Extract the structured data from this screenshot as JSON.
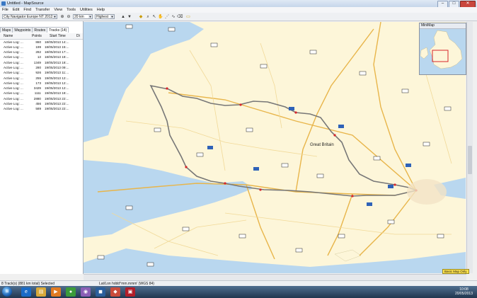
{
  "window": {
    "title": "Untitled - MapSource",
    "min": "–",
    "max": "□",
    "close": "✕"
  },
  "menu": [
    "File",
    "Edit",
    "Find",
    "Transfer",
    "View",
    "Tools",
    "Utilities",
    "Help"
  ],
  "toolbar": {
    "map_product": "City Navigator Europe NT 2012.2",
    "zoom": "20 km",
    "detail": "Highest",
    "icons": [
      "zoom-in-icon",
      "zoom-out-icon",
      "find-icon",
      "select-icon",
      "hand-icon",
      "route-icon",
      "measure-icon"
    ]
  },
  "tabs": [
    "Maps",
    "Waypoints",
    "Routes",
    "Tracks (14)"
  ],
  "tracks_table": {
    "headers": [
      "Name",
      "Points",
      "Start Time",
      "Di"
    ],
    "rows": [
      [
        "Active Log: ...",
        "860",
        "18/05/2013 14:..."
      ],
      [
        "Active Log: ...",
        "199",
        "18/05/2013 15:..."
      ],
      [
        "Active Log: ...",
        "282",
        "18/05/2013 17:..."
      ],
      [
        "Active Log: ...",
        "13",
        "18/05/2013 18:..."
      ],
      [
        "Active Log: ...",
        "1349",
        "18/05/2013 18:..."
      ],
      [
        "Active Log: ...",
        "280",
        "19/05/2013 09:..."
      ],
      [
        "Active Log: ...",
        "926",
        "19/05/2013 11:..."
      ],
      [
        "Active Log: ...",
        "255",
        "19/05/2013 12:..."
      ],
      [
        "Active Log: ...",
        "173",
        "19/05/2013 12:..."
      ],
      [
        "Active Log: ...",
        "3429",
        "19/05/2013 12:..."
      ],
      [
        "Active Log: ...",
        "1111",
        "19/05/2013 18:..."
      ],
      [
        "Active Log: ...",
        "2880",
        "19/05/2013 22:..."
      ],
      [
        "Active Log: ...",
        "456",
        "19/05/2013 22:..."
      ],
      [
        "Active Log: ...",
        "589",
        "19/05/2013 22:..."
      ]
    ]
  },
  "map": {
    "region_label": "Great Britain",
    "minimap_title": "MiniMap",
    "basic_map_badge": "Basic Map Only",
    "colors": {
      "land": "#fdf6d9",
      "sea": "#b9d7ef",
      "track": "#777777",
      "road_major": "#e8b54a",
      "road_minor": "#f1d998"
    }
  },
  "status": {
    "left": "8 Track(s) (881 km total) Selected",
    "right": "Lat/Lon hddd°mm.mmm' (WGS 84)"
  },
  "taskbar": {
    "time": "10:08",
    "date": "20/05/2013"
  }
}
